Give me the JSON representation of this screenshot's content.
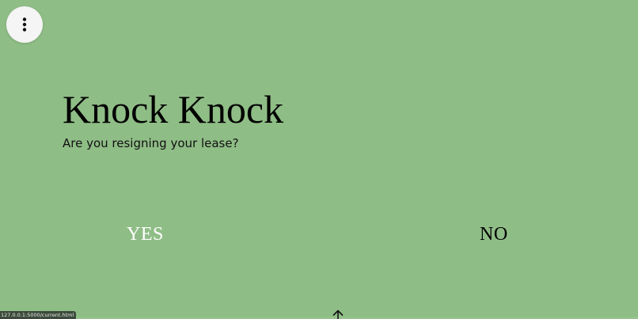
{
  "menu": {
    "icon": "more-vertical-icon"
  },
  "hero": {
    "title": "Knock Knock",
    "question": "Are you resigning your lease?"
  },
  "choices": {
    "yes_label": "YES",
    "no_label": "NO"
  },
  "scroll": {
    "icon": "arrow-up-icon"
  },
  "status_bar": {
    "url": "127.0.0.1:5000/current.html"
  },
  "colors": {
    "background": "#8fbd86",
    "yes_text": "#ffffff",
    "no_text": "#000000",
    "menu_button": "#f5f5f5"
  }
}
